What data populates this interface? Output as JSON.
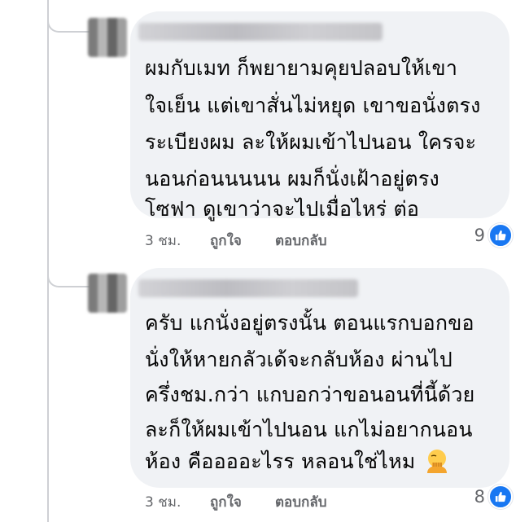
{
  "comments": [
    {
      "lines": [
        "ผมกับเมท ก็พยายามคุยปลอบให้เขา",
        "ใจเย็น แต่เขาสั่นไม่หยุด  เขาขอนั่งตรง",
        "ระเบียงผม  ละให้ผมเข้าไปนอน ใครจะ",
        "นอนก่อนนนนน   ผมก็นั่งเฝ้าอยู่ตรง",
        "โซฟา  ดูเขาว่าจะไปเมื่อไหร่ ต่อ"
      ],
      "time": "3 ชม.",
      "like_label": "ถูกใจ",
      "reply_label": "ตอบกลับ",
      "reaction_count": "9",
      "reaction_icon": "like-icon"
    },
    {
      "lines": [
        "ครับ  แกนั่งอยู่ตรงนั้น ตอนแรกบอกขอ",
        "นั่งให้หายกลัวเด้จะกลับห้อง  ผ่านไป",
        "ครึ่งชม.กว่า แกบอกว่าขอนอนที่นี้ด้วย",
        "ละก็ให้ผมเข้าไปนอน  แกไม่อยากนอน",
        "ห้อง  คืออออะไรร  หลอนใช่ไหม"
      ],
      "trailing_emoji": "face-palm-emoji",
      "time": "3 ชม.",
      "like_label": "ถูกใจ",
      "reply_label": "ตอบกลับ",
      "reaction_count": "8",
      "reaction_icon": "like-icon"
    }
  ],
  "colors": {
    "bubble": "#f0f2f5",
    "meta_text": "#65676b",
    "like_blue": "#1877f2",
    "thread_line": "#ced0d4"
  }
}
